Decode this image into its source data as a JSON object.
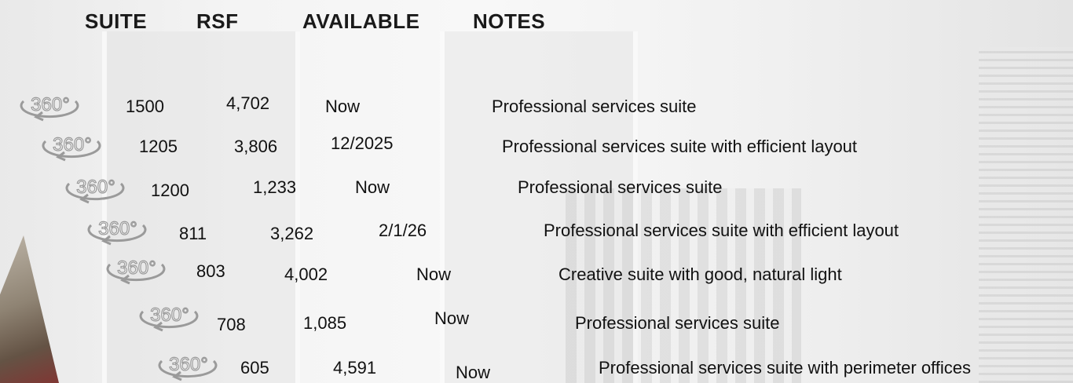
{
  "header": {
    "suite": "SUITE",
    "rsf": "RSF",
    "available": "AVAILABLE",
    "notes": "NOTES"
  },
  "tour_icon": {
    "icon": "360-tour-icon",
    "label": "360°",
    "color": "#9a9a9a"
  },
  "rows": [
    {
      "suite": "1500",
      "rsf": "4,702",
      "available": "Now",
      "notes": "Professional services suite"
    },
    {
      "suite": "1205",
      "rsf": "3,806",
      "available": "12/2025",
      "notes": "Professional services suite with efficient layout"
    },
    {
      "suite": "1200",
      "rsf": "1,233",
      "available": "Now",
      "notes": "Professional services suite"
    },
    {
      "suite": "811",
      "rsf": "3,262",
      "available": "2/1/26",
      "notes": "Professional services suite with efficient layout"
    },
    {
      "suite": "803",
      "rsf": "4,002",
      "available": "Now",
      "notes": "Creative suite with good, natural light"
    },
    {
      "suite": "708",
      "rsf": "1,085",
      "available": "Now",
      "notes": "Professional services suite"
    },
    {
      "suite": "605",
      "rsf": "4,591",
      "available": "Now",
      "notes": "Professional services suite with perimeter offices"
    }
  ]
}
